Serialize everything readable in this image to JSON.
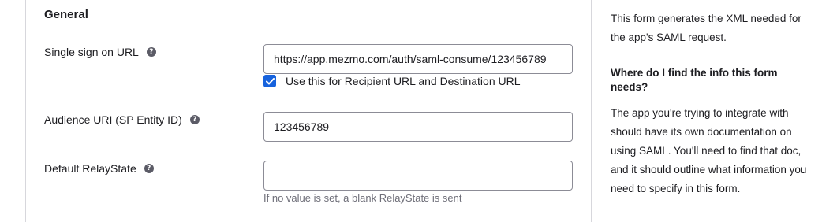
{
  "section": {
    "title": "General"
  },
  "fields": {
    "sso_url": {
      "label": "Single sign on URL",
      "value": "https://app.mezmo.com/auth/saml-consume/123456789",
      "help_icon": "question-circle-icon"
    },
    "recipient_checkbox": {
      "label": "Use this for Recipient URL and Destination URL",
      "checked": true
    },
    "audience_uri": {
      "label": "Audience URI (SP Entity ID)",
      "value": "123456789",
      "help_icon": "question-circle-icon"
    },
    "relay_state": {
      "label": "Default RelayState",
      "value": "",
      "hint": "If no value is set, a blank RelayState is sent",
      "help_icon": "question-circle-icon"
    }
  },
  "help_panel": {
    "intro": "This form generates the XML needed for the app's SAML request.",
    "question": "Where do I find the info this form needs?",
    "answer": "The app you're trying to integrate with should have its own documentation on using SAML. You'll need to find that doc, and it should outline what information you need to specify in this form."
  },
  "colors": {
    "accent": "#1662dd",
    "border": "#8c8c96",
    "divider": "#d7d7dc",
    "hint_text": "#6e6e78"
  }
}
